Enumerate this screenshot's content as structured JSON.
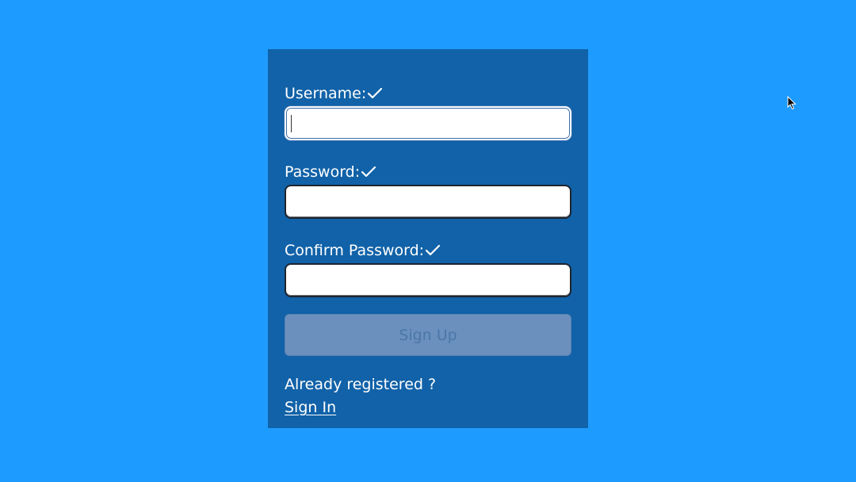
{
  "form": {
    "username_label": "Username:",
    "password_label": "Password:",
    "confirm_password_label": "Confirm Password:",
    "username_value": "",
    "password_value": "",
    "confirm_password_value": "",
    "signup_label": "Sign Up",
    "already_registered_text": "Already registered ?",
    "signin_label": "Sign In"
  },
  "icons": {
    "check": "check-icon",
    "cursor": "mouse-cursor-icon"
  },
  "colors": {
    "background": "#1e9bff",
    "card": "#1162a8",
    "button_disabled": "#6b90bd",
    "text": "#ffffff"
  }
}
